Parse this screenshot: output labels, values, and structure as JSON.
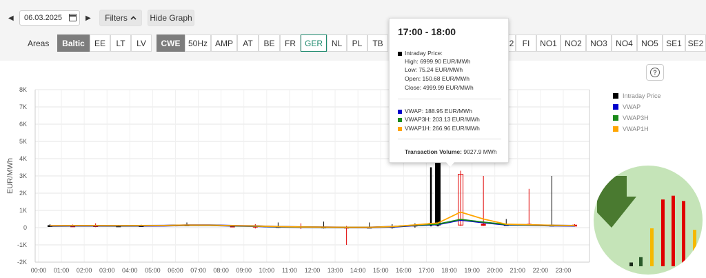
{
  "toolbar": {
    "prev_label": "◀",
    "next_label": "▶",
    "date_value": "06.03.2025",
    "filters_label": "Filters",
    "filters_chevron": "^",
    "hide_graph_label": "Hide Graph",
    "areas_label": "Areas"
  },
  "areas_group1": [
    {
      "label": "Baltic",
      "state": "active-dark"
    },
    {
      "label": "EE",
      "state": ""
    },
    {
      "label": "LT",
      "state": ""
    },
    {
      "label": "LV",
      "state": ""
    }
  ],
  "areas_group2_left": [
    {
      "label": "CWE",
      "state": "active-dark"
    },
    {
      "label": "50Hz",
      "state": ""
    },
    {
      "label": "AMP",
      "state": ""
    },
    {
      "label": "AT",
      "state": ""
    },
    {
      "label": "BE",
      "state": ""
    },
    {
      "label": "FR",
      "state": ""
    },
    {
      "label": "GER",
      "state": "active-green"
    },
    {
      "label": "NL",
      "state": ""
    },
    {
      "label": "PL",
      "state": ""
    },
    {
      "label": "TB",
      "state": ""
    }
  ],
  "areas_group2_right": [
    {
      "label": "2",
      "state": ""
    },
    {
      "label": "FI",
      "state": ""
    },
    {
      "label": "NO1",
      "state": ""
    },
    {
      "label": "NO2",
      "state": ""
    },
    {
      "label": "NO3",
      "state": ""
    },
    {
      "label": "NO4",
      "state": ""
    },
    {
      "label": "NO5",
      "state": ""
    },
    {
      "label": "SE1",
      "state": ""
    },
    {
      "label": "SE2",
      "state": ""
    }
  ],
  "help_icon": "question-circle-icon",
  "legend": [
    {
      "label": "Intraday Price",
      "color": "#000000"
    },
    {
      "label": "VWAP",
      "color": "#0000cc"
    },
    {
      "label": "VWAP3H",
      "color": "#1a8a1a"
    },
    {
      "label": "VWAP1H",
      "color": "#ffa500"
    }
  ],
  "tooltip": {
    "title": "17:00 - 18:00",
    "intraday_label": "Intraday Price:",
    "high": "High: 6999.90 EUR/MWh",
    "low": "Low: 75.24 EUR/MWh",
    "open": "Open: 150.68 EUR/MWh",
    "close": "Close: 4999.99 EUR/MWh",
    "vwap": "VWAP: 188.95 EUR/MWh",
    "vwap3h": "VWAP3H: 203.13 EUR/MWh",
    "vwap1h": "VWAP1H: 266.96 EUR/MWh",
    "volume_label": "Transaction Volume:",
    "volume_value": "9027.9 MWh"
  },
  "chart_data": {
    "type": "line",
    "ylabel": "EUR/MWh",
    "ylim": [
      -2000,
      8000
    ],
    "yticks": [
      "8K",
      "7K",
      "6K",
      "5K",
      "4K",
      "3K",
      "2K",
      "1K",
      "0",
      "-1K",
      "-2K"
    ],
    "yvalues": [
      8000,
      7000,
      6000,
      5000,
      4000,
      3000,
      2000,
      1000,
      0,
      -1000,
      -2000
    ],
    "xticks": [
      "00:00",
      "01:00",
      "02:00",
      "03:00",
      "04:00",
      "05:00",
      "06:00",
      "07:00",
      "08:00",
      "09:00",
      "10:00",
      "11:00",
      "12:00",
      "13:00",
      "14:00",
      "15:00",
      "16:00",
      "17:00",
      "18:00",
      "19:00",
      "20:00",
      "21:00",
      "22:00",
      "23:00"
    ],
    "grid": true,
    "series": [
      {
        "name": "VWAP",
        "color": "#0000cc",
        "x": [
          0.5,
          1.5,
          2.5,
          3.5,
          4.5,
          5.5,
          6.5,
          7.5,
          8.5,
          9.5,
          10.5,
          11.5,
          12.5,
          13.5,
          14.5,
          15.5,
          16.5,
          17.5,
          18.5,
          19.5,
          20.5,
          21.5,
          22.5,
          23.5
        ],
        "values": [
          100,
          110,
          110,
          105,
          110,
          115,
          140,
          140,
          110,
          90,
          50,
          30,
          20,
          10,
          10,
          50,
          130,
          189,
          450,
          300,
          170,
          150,
          120,
          110
        ]
      },
      {
        "name": "VWAP3H",
        "color": "#1a8a1a",
        "x": [
          0.5,
          1.5,
          2.5,
          3.5,
          4.5,
          5.5,
          6.5,
          7.5,
          8.5,
          9.5,
          10.5,
          11.5,
          12.5,
          13.5,
          14.5,
          15.5,
          16.5,
          17.5,
          18.5,
          19.5,
          20.5,
          21.5,
          22.5,
          23.5
        ],
        "values": [
          105,
          110,
          110,
          108,
          112,
          120,
          140,
          138,
          108,
          88,
          52,
          32,
          22,
          12,
          15,
          55,
          140,
          203,
          480,
          320,
          180,
          155,
          125,
          115
        ]
      },
      {
        "name": "VWAP1H",
        "color": "#ffa500",
        "x": [
          0.5,
          1.5,
          2.5,
          3.5,
          4.5,
          5.5,
          6.5,
          7.5,
          8.5,
          9.5,
          10.5,
          11.5,
          12.5,
          13.5,
          14.5,
          15.5,
          16.5,
          17.5,
          18.5,
          19.5,
          20.5,
          21.5,
          22.5,
          23.5
        ],
        "values": [
          110,
          115,
          115,
          110,
          115,
          125,
          150,
          145,
          115,
          95,
          60,
          40,
          30,
          20,
          20,
          60,
          160,
          267,
          900,
          500,
          200,
          170,
          140,
          120
        ]
      }
    ],
    "candles": [
      {
        "x": 0.5,
        "open": 80,
        "close": 120,
        "high": 200,
        "low": 40,
        "color": "#000000"
      },
      {
        "x": 1.5,
        "open": 110,
        "close": 90,
        "high": 180,
        "low": 60,
        "color": "#e00000"
      },
      {
        "x": 2.5,
        "open": 120,
        "close": 80,
        "high": 250,
        "low": 30,
        "color": "#e00000"
      },
      {
        "x": 3.5,
        "open": 90,
        "close": 110,
        "high": 160,
        "low": 50,
        "color": "#000000"
      },
      {
        "x": 4.5,
        "open": 100,
        "close": 120,
        "high": 170,
        "low": 70,
        "color": "#000000"
      },
      {
        "x": 6.5,
        "open": 120,
        "close": 160,
        "high": 300,
        "low": 90,
        "color": "#000000"
      },
      {
        "x": 8.5,
        "open": 100,
        "close": 60,
        "high": 150,
        "low": 20,
        "color": "#e00000"
      },
      {
        "x": 9.5,
        "open": 90,
        "close": 50,
        "high": 200,
        "low": -50,
        "color": "#e00000"
      },
      {
        "x": 10.5,
        "open": 40,
        "close": 70,
        "high": 300,
        "low": -20,
        "color": "#000000"
      },
      {
        "x": 11.5,
        "open": 60,
        "close": 20,
        "high": 250,
        "low": -80,
        "color": "#e00000"
      },
      {
        "x": 12.5,
        "open": 20,
        "close": 40,
        "high": 350,
        "low": -50,
        "color": "#000000"
      },
      {
        "x": 13.5,
        "open": 30,
        "close": 10,
        "high": 100,
        "low": -1000,
        "color": "#e00000"
      },
      {
        "x": 14.5,
        "open": 10,
        "close": 30,
        "high": 300,
        "low": -40,
        "color": "#000000"
      },
      {
        "x": 15.5,
        "open": 40,
        "close": 70,
        "high": 200,
        "low": -60,
        "color": "#000000"
      },
      {
        "x": 16.5,
        "open": 110,
        "close": 150,
        "high": 250,
        "low": 0,
        "color": "#000000"
      },
      {
        "x": 17.2,
        "open": 150,
        "close": 250,
        "high": 3500,
        "low": 75,
        "color": "#000000"
      },
      {
        "x": 17.5,
        "open": 150.68,
        "close": 4999.99,
        "high": 6999.9,
        "low": 75.24,
        "color": "#000000"
      },
      {
        "x": 18.5,
        "open": 3100,
        "close": 150,
        "high": 3300,
        "low": 100,
        "color": "#e00000"
      },
      {
        "x": 19.5,
        "open": 200,
        "close": 130,
        "high": 3000,
        "low": 100,
        "color": "#e00000"
      },
      {
        "x": 20.5,
        "open": 120,
        "close": 180,
        "high": 500,
        "low": 100,
        "color": "#000000"
      },
      {
        "x": 21.5,
        "open": 200,
        "close": 140,
        "high": 2250,
        "low": 100,
        "color": "#e00000"
      },
      {
        "x": 22.5,
        "open": 150,
        "close": 120,
        "high": 3000,
        "low": 100,
        "color": "#000000"
      },
      {
        "x": 23.5,
        "open": 150,
        "close": 100,
        "high": 200,
        "low": 60,
        "color": "#e00000"
      }
    ]
  },
  "overlay": {
    "arrow_icon": "down-right-arrow-icon",
    "bars": [
      {
        "value": 0.05,
        "color": "#1a2a1a"
      },
      {
        "value": 0.12,
        "color": "#2a5a2a"
      },
      {
        "value": 0.5,
        "color": "#f5b800"
      },
      {
        "value": 0.88,
        "color": "#e00000"
      },
      {
        "value": 0.93,
        "color": "#e00000"
      },
      {
        "value": 0.86,
        "color": "#e00000"
      },
      {
        "value": 0.48,
        "color": "#f5b800"
      }
    ]
  }
}
